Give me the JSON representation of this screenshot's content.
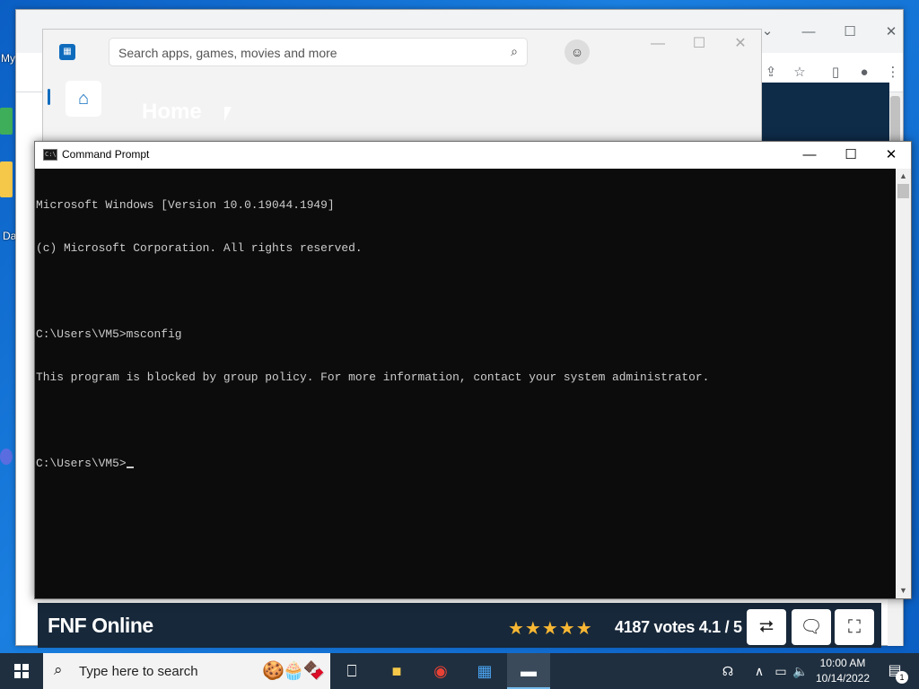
{
  "desktop": {
    "left_label_1": "My",
    "left_label_2": "Da"
  },
  "chrome": {
    "minimize": "—",
    "maximize": "☐",
    "close": "✕",
    "dropdown": "⌄",
    "share": "⇪",
    "bookmark": "☆",
    "sidepanel": "▯",
    "profile": "●",
    "menu": "⋮"
  },
  "store": {
    "search_placeholder": "Search apps, games, movies and more",
    "home_label": "Home",
    "min": "—",
    "max": "☐",
    "close": "✕"
  },
  "game": {
    "title": "FNF Online",
    "stars": "★★★★★",
    "votes_text": "4187 votes 4.1 / 5",
    "rating": 4.1
  },
  "cmd": {
    "title": "Command Prompt",
    "lines": [
      "Microsoft Windows [Version 10.0.19044.1949]",
      "(c) Microsoft Corporation. All rights reserved.",
      "",
      "C:\\Users\\VM5>msconfig",
      "This program is blocked by group policy. For more information, contact your system administrator.",
      "",
      "C:\\Users\\VM5>"
    ]
  },
  "taskbar": {
    "search_placeholder": "Type here to search",
    "time": "10:00 AM",
    "date": "10/14/2022",
    "notification_count": "1"
  }
}
